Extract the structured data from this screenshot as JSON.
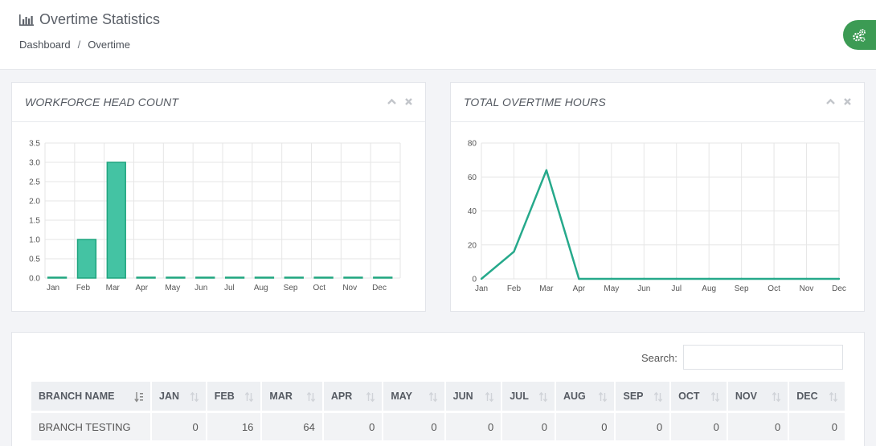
{
  "header": {
    "title": "Overtime Statistics",
    "title_icon": "bar-chart-icon",
    "breadcrumb": [
      "Dashboard",
      "Overtime"
    ],
    "breadcrumb_separator": "/",
    "settings_icon": "gears-icon",
    "accent_color": "#3c9b54"
  },
  "panels": {
    "headcount": {
      "title": "WORKFORCE HEAD COUNT"
    },
    "overtime": {
      "title": "TOTAL OVERTIME HOURS"
    }
  },
  "chart_data": [
    {
      "type": "bar",
      "categories": [
        "Jan",
        "Feb",
        "Mar",
        "Apr",
        "May",
        "Jun",
        "Jul",
        "Aug",
        "Sep",
        "Oct",
        "Nov",
        "Dec"
      ],
      "values": [
        0,
        1,
        3,
        0,
        0,
        0,
        0,
        0,
        0,
        0,
        0,
        0
      ],
      "y_ticks": [
        "0.0",
        "0.5",
        "1.0",
        "1.5",
        "2.0",
        "2.5",
        "3.0",
        "3.5"
      ],
      "ylim": [
        0,
        3.5
      ],
      "grid": true,
      "color": "#44c3a3",
      "border_color": "#1fa57f"
    },
    {
      "type": "line",
      "categories": [
        "Jan",
        "Feb",
        "Mar",
        "Apr",
        "May",
        "Jun",
        "Jul",
        "Aug",
        "Sep",
        "Oct",
        "Nov",
        "Dec"
      ],
      "values": [
        0,
        16,
        64,
        0,
        0,
        0,
        0,
        0,
        0,
        0,
        0,
        0
      ],
      "y_ticks": [
        "0",
        "20",
        "40",
        "60",
        "80"
      ],
      "ylim": [
        0,
        80
      ],
      "grid": true,
      "color": "#26a98b"
    }
  ],
  "table": {
    "search_label": "Search:",
    "search_value": "",
    "columns": [
      "BRANCH NAME",
      "JAN",
      "FEB",
      "MAR",
      "APR",
      "MAY",
      "JUN",
      "JUL",
      "AUG",
      "SEP",
      "OCT",
      "NOV",
      "DEC"
    ],
    "rows": [
      {
        "cells": [
          "BRANCH TESTING",
          "0",
          "16",
          "64",
          "0",
          "0",
          "0",
          "0",
          "0",
          "0",
          "0",
          "0",
          "0"
        ]
      }
    ]
  }
}
